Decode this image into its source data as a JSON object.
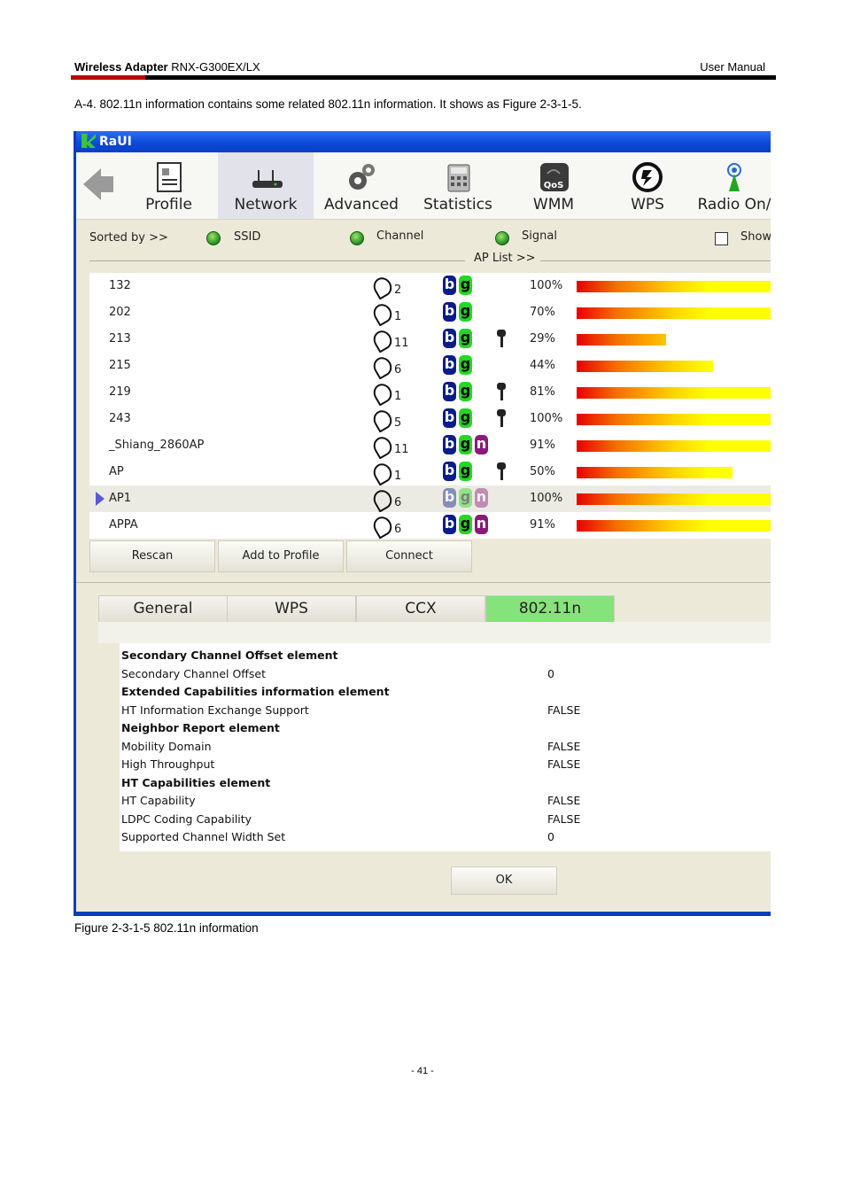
{
  "header": {
    "product_bold": "Wireless Adapter",
    "product_model": " RNX-G300EX/LX",
    "doc_type": "User Manual"
  },
  "intro_text": "A-4. 802.11n information contains some related 802.11n information. It shows as Figure 2-3-1-5.",
  "app": {
    "title": "RaUI",
    "toolbar": [
      {
        "label": "Profile",
        "icon": "profile-icon"
      },
      {
        "label": "Network",
        "icon": "router-icon",
        "active": true
      },
      {
        "label": "Advanced",
        "icon": "gears-icon"
      },
      {
        "label": "Statistics",
        "icon": "calculator-icon"
      },
      {
        "label": "WMM",
        "icon": "qos-icon"
      },
      {
        "label": "WPS",
        "icon": "wps-icon"
      },
      {
        "label": "Radio On/",
        "icon": "antenna-icon"
      }
    ],
    "sort": {
      "label": "Sorted by >>",
      "ssid": "SSID",
      "channel": "Channel",
      "signal": "Signal",
      "show": "Show"
    },
    "ap_list_label": "AP List >>",
    "ap_rows": [
      {
        "ssid": "132",
        "channel": "2",
        "modes": [
          "b",
          "g"
        ],
        "secured": false,
        "signal": "100%",
        "signal_value": 100
      },
      {
        "ssid": "202",
        "channel": "1",
        "modes": [
          "b",
          "g"
        ],
        "secured": false,
        "signal": "70%",
        "signal_value": 100
      },
      {
        "ssid": "213",
        "channel": "11",
        "modes": [
          "b",
          "g"
        ],
        "secured": true,
        "signal": "29%",
        "signal_value": 46
      },
      {
        "ssid": "215",
        "channel": "6",
        "modes": [
          "b",
          "g"
        ],
        "secured": false,
        "signal": "44%",
        "signal_value": 70
      },
      {
        "ssid": "219",
        "channel": "1",
        "modes": [
          "b",
          "g"
        ],
        "secured": true,
        "signal": "81%",
        "signal_value": 100
      },
      {
        "ssid": "243",
        "channel": "5",
        "modes": [
          "b",
          "g"
        ],
        "secured": true,
        "signal": "100%",
        "signal_value": 100
      },
      {
        "ssid": "_Shiang_2860AP",
        "channel": "11",
        "modes": [
          "b",
          "g",
          "n"
        ],
        "secured": false,
        "signal": "91%",
        "signal_value": 100
      },
      {
        "ssid": "AP",
        "channel": "1",
        "modes": [
          "b",
          "g"
        ],
        "secured": true,
        "signal": "50%",
        "signal_value": 80
      },
      {
        "ssid": "AP1",
        "channel": "6",
        "modes": [
          "b",
          "g",
          "n"
        ],
        "secured": false,
        "signal": "100%",
        "signal_value": 100,
        "selected": true
      },
      {
        "ssid": "APPA",
        "channel": "6",
        "modes": [
          "b",
          "g",
          "n"
        ],
        "secured": false,
        "signal": "91%",
        "signal_value": 100
      }
    ],
    "buttons": {
      "rescan": "Rescan",
      "add_to_profile": "Add to Profile",
      "connect": "Connect"
    },
    "tabs": [
      {
        "label": "General"
      },
      {
        "label": "WPS"
      },
      {
        "label": "CCX"
      },
      {
        "label": "802.11n",
        "active": true
      }
    ],
    "info_lines": [
      {
        "text": "Secondary Channel Offset element",
        "bold": true,
        "value": ""
      },
      {
        "text": "Secondary Channel Offset",
        "bold": false,
        "value": "0"
      },
      {
        "text": "Extended Capabilities information element",
        "bold": true,
        "value": ""
      },
      {
        "text": "HT Information Exchange Support",
        "bold": false,
        "value": "FALSE"
      },
      {
        "text": "Neighbor Report element",
        "bold": true,
        "value": ""
      },
      {
        "text": "Mobility Domain",
        "bold": false,
        "value": "FALSE"
      },
      {
        "text": "High Throughput",
        "bold": false,
        "value": "FALSE"
      },
      {
        "text": "HT Capabilities element",
        "bold": true,
        "value": ""
      },
      {
        "text": "HT Capability",
        "bold": false,
        "value": "FALSE"
      },
      {
        "text": "LDPC Coding Capability",
        "bold": false,
        "value": "FALSE"
      },
      {
        "text": "Supported Channel Width Set",
        "bold": false,
        "value": "0"
      }
    ],
    "ok_label": "OK"
  },
  "caption": "Figure 2-3-1-5 802.11n information",
  "page_number": "- 41 -"
}
